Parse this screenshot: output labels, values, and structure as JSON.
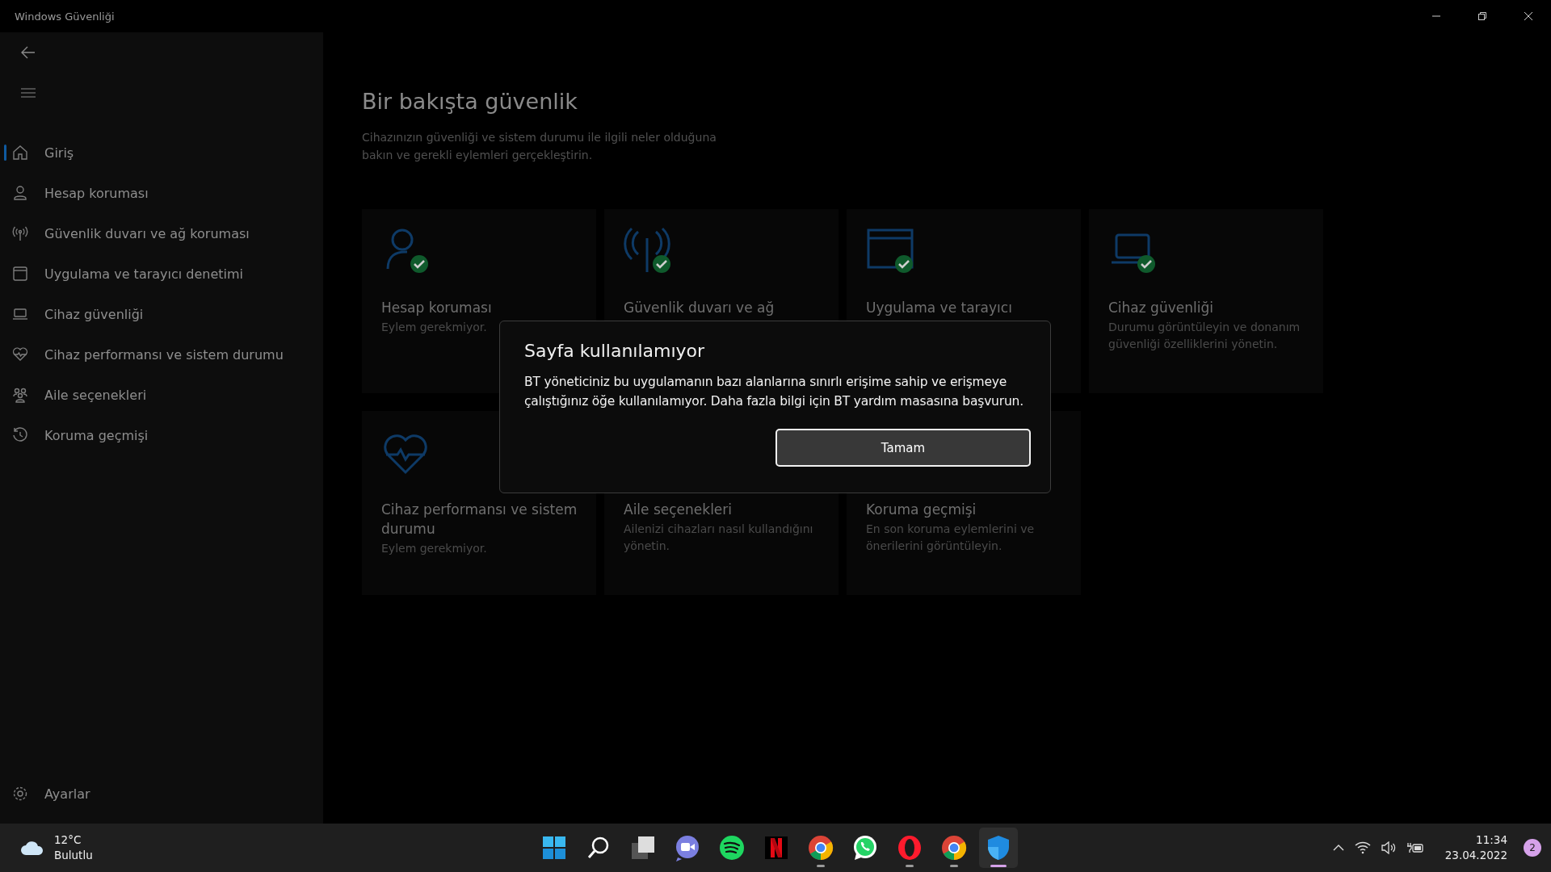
{
  "window": {
    "title": "Windows Güvenliği"
  },
  "sidebar": {
    "items": [
      {
        "label": "Giriş",
        "kind": "home",
        "selected": true
      },
      {
        "label": "Hesap koruması",
        "kind": "person",
        "selected": false
      },
      {
        "label": "Güvenlik duvarı ve ağ koruması",
        "kind": "antenna",
        "selected": false
      },
      {
        "label": "Uygulama ve tarayıcı denetimi",
        "kind": "window",
        "selected": false
      },
      {
        "label": "Cihaz güvenliği",
        "kind": "laptop",
        "selected": false
      },
      {
        "label": "Cihaz performansı ve sistem durumu",
        "kind": "heart",
        "selected": false
      },
      {
        "label": "Aile seçenekleri",
        "kind": "family",
        "selected": false
      },
      {
        "label": "Koruma geçmişi",
        "kind": "history",
        "selected": false
      }
    ],
    "settings": {
      "label": "Ayarlar"
    }
  },
  "page": {
    "title": "Bir bakışta güvenlik",
    "description": "Cihazınızın güvenliği ve sistem durumu ile ilgili neler olduğuna bakın ve gerekli eylemleri gerçekleştirin."
  },
  "cards": [
    {
      "kind": "person",
      "title": "Hesap koruması",
      "description": "Eylem gerekmiyor."
    },
    {
      "kind": "antenna",
      "title": "Güvenlik duvarı ve ağ"
    },
    {
      "kind": "window",
      "title": "Uygulama ve tarayıcı"
    },
    {
      "kind": "laptop",
      "title": "Cihaz güvenliği",
      "description": "Durumu görüntüleyin ve donanım güvenliği özelliklerini yönetin."
    },
    {
      "kind": "heart",
      "title": "Cihaz performansı ve sistem durumu",
      "description": "Eylem gerekmiyor."
    },
    {
      "title": "Aile seçenekleri",
      "description": "Ailenizi cihazları nasıl kullandığını yönetin."
    },
    {
      "title": "Koruma geçmişi",
      "description": "En son koruma eylemlerini ve önerilerini görüntüleyin."
    }
  ],
  "dialog": {
    "title": "Sayfa kullanılamıyor",
    "message": "BT yöneticiniz bu uygulamanın bazı alanlarına sınırlı erişime sahip ve erişmeye çalıştığınız öğe kullanılamıyor. Daha fazla bilgi için BT yardım masasına başvurun.",
    "button": "Tamam"
  },
  "taskbar": {
    "weather": {
      "temperature": "12°C",
      "condition": "Bulutlu"
    },
    "apps": [
      {
        "kind": "start",
        "running": false,
        "active": false
      },
      {
        "kind": "search",
        "running": false,
        "active": false
      },
      {
        "kind": "taskview",
        "running": false,
        "active": false
      },
      {
        "kind": "chat",
        "running": false,
        "active": false
      },
      {
        "kind": "music",
        "running": false,
        "active": false
      },
      {
        "kind": "video",
        "running": false,
        "active": false
      },
      {
        "kind": "browser",
        "running": true,
        "active": false
      },
      {
        "kind": "messenger",
        "running": false,
        "active": false
      },
      {
        "kind": "opera",
        "running": true,
        "active": false
      },
      {
        "kind": "browser",
        "running": true,
        "active": false
      },
      {
        "kind": "shield",
        "running": true,
        "active": true
      }
    ],
    "time": "11:34",
    "date": "23.04.2022",
    "notifications": "2"
  }
}
